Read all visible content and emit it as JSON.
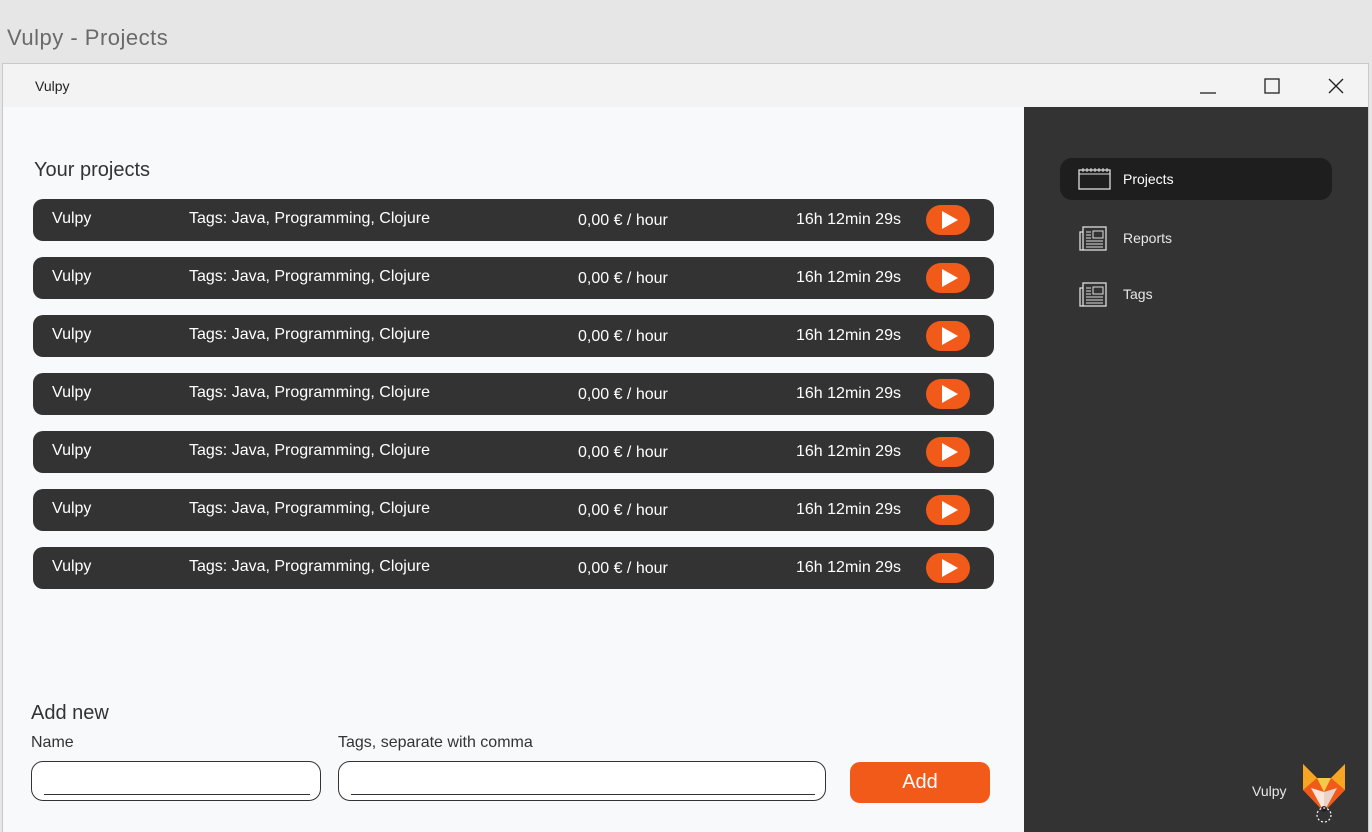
{
  "window": {
    "outer_title": "Vulpy - Projects",
    "app_name": "Vulpy"
  },
  "main": {
    "section_title": "Your projects",
    "projects": [
      {
        "name": "Vulpy",
        "tags": "Tags: Java, Programming, Clojure",
        "rate": "0,00 € / hour",
        "time": "16h 12min 29s"
      },
      {
        "name": "Vulpy",
        "tags": "Tags: Java, Programming, Clojure",
        "rate": "0,00 € / hour",
        "time": "16h 12min 29s"
      },
      {
        "name": "Vulpy",
        "tags": "Tags: Java, Programming, Clojure",
        "rate": "0,00 € / hour",
        "time": "16h 12min 29s"
      },
      {
        "name": "Vulpy",
        "tags": "Tags: Java, Programming, Clojure",
        "rate": "0,00 € / hour",
        "time": "16h 12min 29s"
      },
      {
        "name": "Vulpy",
        "tags": "Tags: Java, Programming, Clojure",
        "rate": "0,00 € / hour",
        "time": "16h 12min 29s"
      },
      {
        "name": "Vulpy",
        "tags": "Tags: Java, Programming, Clojure",
        "rate": "0,00 € / hour",
        "time": "16h 12min 29s"
      },
      {
        "name": "Vulpy",
        "tags": "Tags: Java, Programming, Clojure",
        "rate": "0,00 € / hour",
        "time": "16h 12min 29s"
      }
    ],
    "add_new": {
      "title": "Add new",
      "name_label": "Name",
      "name_value": "",
      "tags_label": "Tags, separate with comma",
      "tags_value": "",
      "button_label": "Add"
    }
  },
  "sidebar": {
    "items": [
      {
        "label": "Projects",
        "icon": "calendar-icon",
        "active": true
      },
      {
        "label": "Reports",
        "icon": "newspaper-icon",
        "active": false
      },
      {
        "label": "Tags",
        "icon": "newspaper-icon",
        "active": false
      }
    ],
    "brand_name": "Vulpy",
    "brand_icon": "fox-logo-icon"
  },
  "colors": {
    "accent": "#f25a1a",
    "dark": "#333333",
    "active_nav": "#1e1e1e",
    "background": "#f8f9fb"
  }
}
